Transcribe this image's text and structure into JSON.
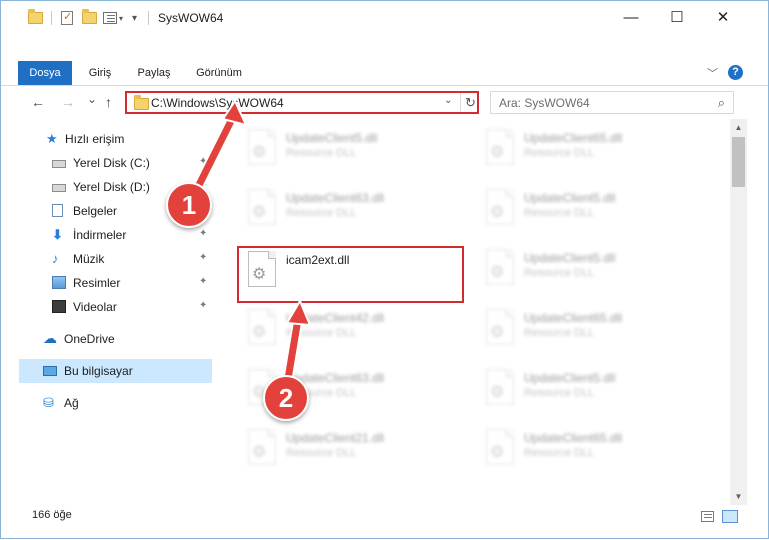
{
  "window": {
    "title": "SysWOW64",
    "minimize": "—",
    "maximize": "☐",
    "close": "✕"
  },
  "ribbon": {
    "tabs": [
      "Dosya",
      "Giriş",
      "Paylaş",
      "Görünüm"
    ],
    "help": "?",
    "collapse": "﹀"
  },
  "nav": {
    "back": "←",
    "forward": "→",
    "recent": "⌄",
    "up": "↑",
    "address": "C:\\Windows\\SysWOW64",
    "address_dropdown": "⌄",
    "refresh": "↻",
    "search_placeholder": "Ara: SysWOW64",
    "search_icon": "search-icon"
  },
  "sidebar": {
    "items": [
      {
        "label": "Hızlı erişim",
        "icon": "star-icon",
        "pinned": false
      },
      {
        "label": "Yerel Disk (C:)",
        "icon": "disk-icon",
        "pinned": true
      },
      {
        "label": "Yerel Disk (D:)",
        "icon": "disk-icon",
        "pinned": true
      },
      {
        "label": "Belgeler",
        "icon": "documents-icon",
        "pinned": true
      },
      {
        "label": "İndirmeler",
        "icon": "downloads-icon",
        "pinned": true
      },
      {
        "label": "Müzik",
        "icon": "music-icon",
        "pinned": true
      },
      {
        "label": "Resimler",
        "icon": "pictures-icon",
        "pinned": true
      },
      {
        "label": "Videolar",
        "icon": "videos-icon",
        "pinned": true
      },
      {
        "label": "OneDrive",
        "icon": "onedrive-icon",
        "pinned": false
      },
      {
        "label": "Bu bilgisayar",
        "icon": "this-pc-icon",
        "pinned": false,
        "selected": true
      },
      {
        "label": "Ağ",
        "icon": "network-icon",
        "pinned": false
      }
    ],
    "pin_glyph": "📌"
  },
  "files": {
    "left": [
      {
        "name": "UpdateClient5.dll",
        "type": "Resource DLL",
        "blurred": true
      },
      {
        "name": "UpdateClient63.dll",
        "type": "Resource DLL",
        "blurred": true
      },
      {
        "name": "icam2ext.dll",
        "type": "",
        "blurred": false,
        "highlighted": true
      },
      {
        "name": "UpdateClient42.dll",
        "type": "Resource DLL",
        "blurred": true
      },
      {
        "name": "UpdateClient63.dll",
        "type": "Resource DLL",
        "blurred": true
      },
      {
        "name": "UpdateClient21.dll",
        "type": "Resource DLL",
        "blurred": true
      }
    ],
    "right": [
      {
        "name": "UpdateClient65.dll",
        "type": "Resource DLL",
        "blurred": true
      },
      {
        "name": "UpdateClient5.dll",
        "type": "Resource DLL",
        "blurred": true
      },
      {
        "name": "UpdateClient5.dll",
        "type": "Resource DLL",
        "blurred": true
      },
      {
        "name": "UpdateClient65.dll",
        "type": "Resource DLL",
        "blurred": true
      },
      {
        "name": "UpdateClient5.dll",
        "type": "Resource DLL",
        "blurred": true
      },
      {
        "name": "UpdateClient65.dll",
        "type": "Resource DLL",
        "blurred": true
      }
    ]
  },
  "status": {
    "count": "166 öğe"
  },
  "annotations": {
    "step1": "1",
    "step2": "2",
    "color": "#e3413b"
  }
}
